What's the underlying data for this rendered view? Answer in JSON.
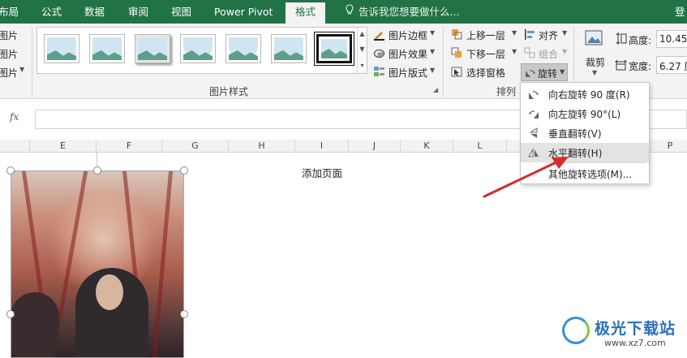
{
  "tabs": [
    {
      "label": "布局"
    },
    {
      "label": "公式"
    },
    {
      "label": "数据"
    },
    {
      "label": "审阅"
    },
    {
      "label": "视图"
    },
    {
      "label": "Power Pivot"
    },
    {
      "label": "格式",
      "active": true
    }
  ],
  "tell_me": "告诉我您想要做什么...",
  "signin": "登",
  "left_stub": [
    "图片",
    "图片",
    "图片"
  ],
  "picture_styles": {
    "group_label": "图片样式",
    "border": "图片边框",
    "effects": "图片效果",
    "layout": "图片版式"
  },
  "arrange": {
    "group_label": "排列",
    "bring_forward": "上移一层",
    "send_backward": "下移一层",
    "selection_pane": "选择窗格",
    "align": "对齐",
    "group": "组合",
    "rotate": "旋转"
  },
  "size": {
    "crop": "裁剪",
    "height_label": "高度:",
    "height_value": "10.45",
    "width_label": "宽度:",
    "width_value": "6.27 厘"
  },
  "formula_bar": {
    "fx": "fx"
  },
  "columns": [
    "E",
    "F",
    "G",
    "H",
    "I",
    "J",
    "K",
    "L",
    "P"
  ],
  "sheet": {
    "cell_text": "添加页面"
  },
  "rotate_menu": {
    "items": [
      {
        "label": "向右旋转 90 度(R)",
        "icon": "rotate-right-icon"
      },
      {
        "label": "向左旋转 90°(L)",
        "icon": "rotate-left-icon"
      },
      {
        "label": "垂直翻转(V)",
        "icon": "flip-vertical-icon"
      },
      {
        "label": "水平翻转(H)",
        "icon": "flip-horizontal-icon",
        "highlighted": true
      },
      {
        "label": "其他旋转选项(M)...",
        "icon": ""
      }
    ]
  },
  "watermark": {
    "name": "极光下载站",
    "url": "www.xz7.com"
  },
  "colors": {
    "accent": "#217346",
    "arrow": "#d42b2b",
    "ribbon": "#f3f3f3"
  }
}
